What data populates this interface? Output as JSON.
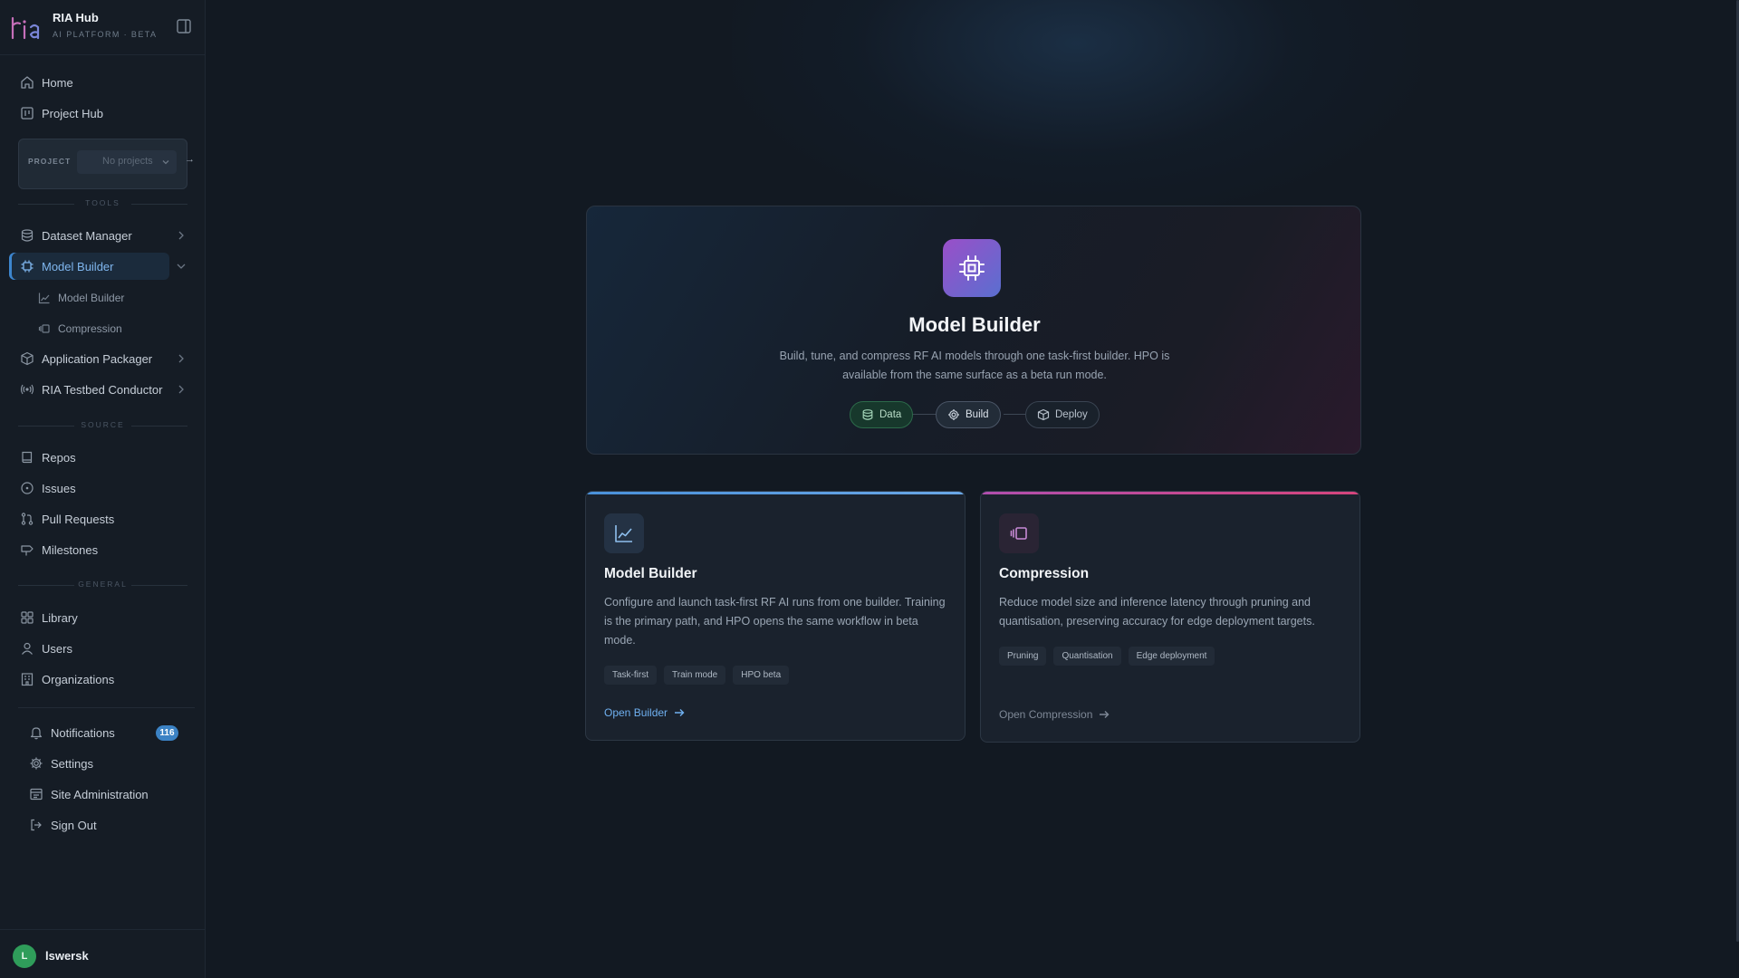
{
  "brand": {
    "title": "RIA Hub",
    "subtitle": "AI PLATFORM · BETA"
  },
  "nav_top": [
    {
      "label": "Home",
      "icon": "home-icon"
    },
    {
      "label": "Project Hub",
      "icon": "project-hub-icon"
    }
  ],
  "project": {
    "label": "PROJECT",
    "select_value": "No projects",
    "go": "→"
  },
  "sections": {
    "tools": "TOOLS",
    "source": "SOURCE",
    "general": "GENERAL"
  },
  "tools": [
    {
      "label": "Dataset Manager",
      "icon": "database-icon"
    },
    {
      "label": "Model Builder",
      "icon": "cpu-icon",
      "active": true
    },
    {
      "label": "Model Builder",
      "icon": "chart-line-icon",
      "sub": true
    },
    {
      "label": "Compression",
      "icon": "compress-icon",
      "sub": true
    },
    {
      "label": "Application Packager",
      "icon": "package-icon"
    },
    {
      "label": "RIA Testbed Conductor",
      "icon": "radio-icon"
    }
  ],
  "source": [
    {
      "label": "Repos",
      "icon": "repo-icon"
    },
    {
      "label": "Issues",
      "icon": "issue-icon"
    },
    {
      "label": "Pull Requests",
      "icon": "pull-request-icon"
    },
    {
      "label": "Milestones",
      "icon": "milestone-icon"
    }
  ],
  "general": [
    {
      "label": "Library",
      "icon": "library-icon"
    },
    {
      "label": "Users",
      "icon": "user-icon"
    },
    {
      "label": "Organizations",
      "icon": "organization-icon"
    }
  ],
  "bottom": [
    {
      "label": "Notifications",
      "icon": "bell-icon",
      "badge": "116"
    },
    {
      "label": "Settings",
      "icon": "gear-icon"
    },
    {
      "label": "Site Administration",
      "icon": "admin-icon"
    },
    {
      "label": "Sign Out",
      "icon": "sign-out-icon"
    }
  ],
  "user": {
    "initial": "L",
    "name": "lswersk",
    "avatar_color": "#2f9d5a"
  },
  "hero": {
    "title": "Model Builder",
    "description": "Build, tune, and compress RF AI models through one task-first builder. HPO is available from the same surface as a beta run mode.",
    "steps": [
      {
        "label": "Data"
      },
      {
        "label": "Build"
      },
      {
        "label": "Deploy"
      }
    ]
  },
  "cards": [
    {
      "title": "Model Builder",
      "description": "Configure and launch task-first RF AI runs from one builder. Training is the primary path, and HPO opens the same workflow in beta mode.",
      "tags": [
        "Task-first",
        "Train mode",
        "HPO beta"
      ],
      "link": "Open Builder",
      "accent": "#4a91da"
    },
    {
      "title": "Compression",
      "description": "Reduce model size and inference latency through pruning and quantisation, preserving accuracy for edge deployment targets.",
      "tags": [
        "Pruning",
        "Quantisation",
        "Edge deployment"
      ],
      "link": "Open Compression",
      "accent": "#c64a8e"
    }
  ]
}
